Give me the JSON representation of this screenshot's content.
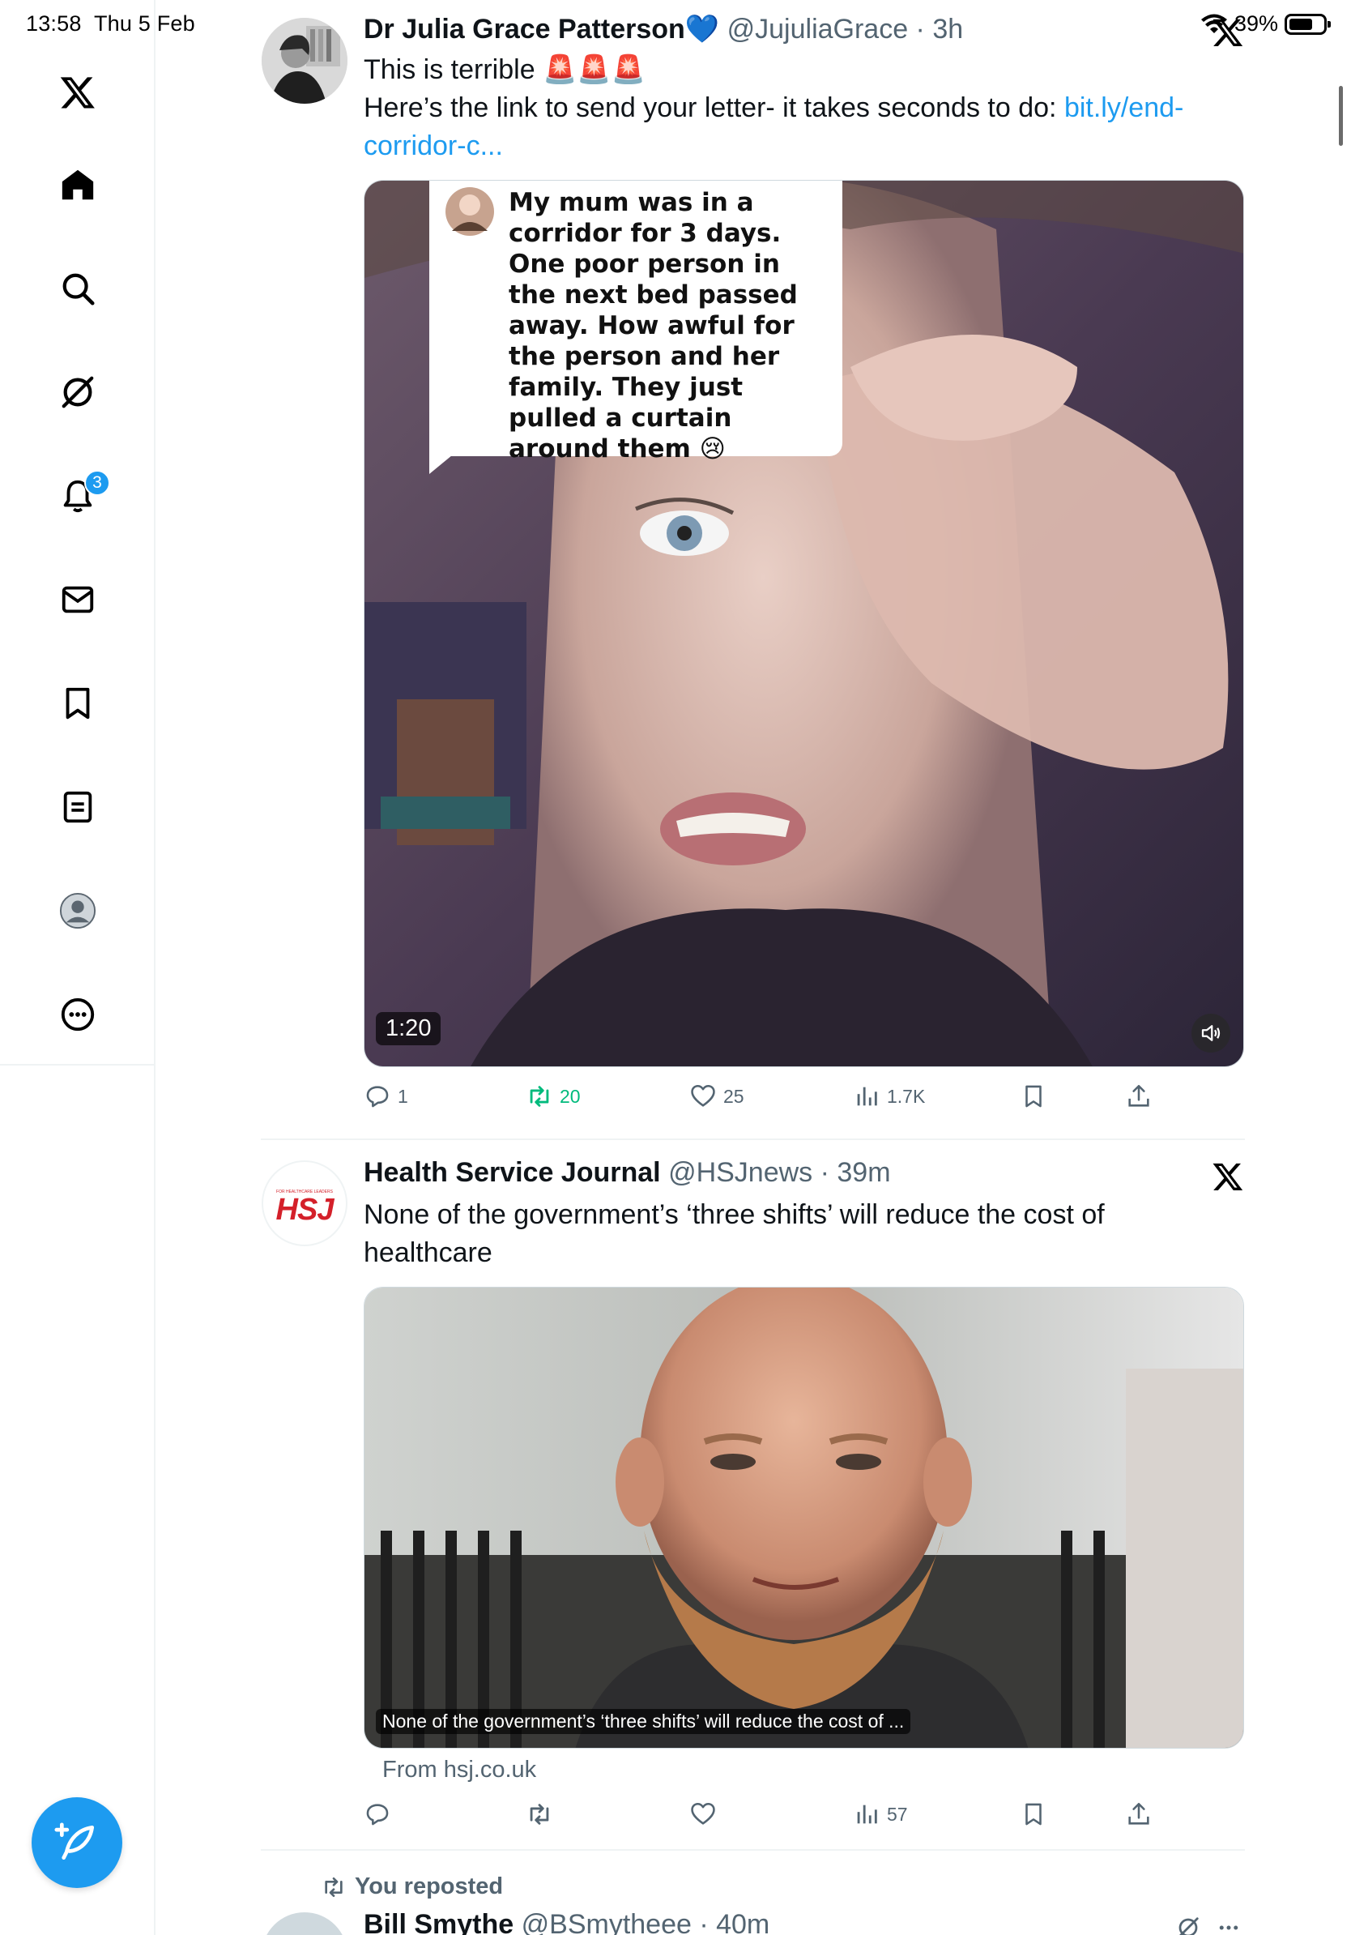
{
  "status_bar": {
    "time": "13:58",
    "date": "Thu 5 Feb",
    "battery": "39%"
  },
  "sidebar": {
    "items": [
      {
        "name": "x-logo-icon"
      },
      {
        "name": "home-icon"
      },
      {
        "name": "search-icon"
      },
      {
        "name": "grok-icon"
      },
      {
        "name": "notifications-icon",
        "badge": "3"
      },
      {
        "name": "messages-icon"
      },
      {
        "name": "bookmarks-icon"
      },
      {
        "name": "lists-icon"
      },
      {
        "name": "profile-icon"
      },
      {
        "name": "more-icon"
      }
    ],
    "compose_icon": "compose-feather-icon"
  },
  "colors": {
    "accent": "#1d9bf0",
    "retweet_green": "#00ba7c",
    "text": "#0f1419",
    "muted": "#536471"
  },
  "tweets": [
    {
      "display_name": "Dr Julia Grace Patterson",
      "verified_emoji": "💙",
      "handle_time": "@JujuliaGrace · 3h",
      "line1": "This is terrible 🚨🚨🚨",
      "line2": "Here’s the link to send your letter- it takes seconds to do: ",
      "link": "bit.ly/end-corridor-c...",
      "video": {
        "caption_text": "My mum was in a corridor for 3 days. One poor person in the next bed passed away. How awful for the person and her family. They just pulled a curtain around them 😢",
        "duration": "1:20"
      },
      "actions": {
        "replies": "1",
        "reposts": "20",
        "likes": "25",
        "views": "1.7K"
      }
    },
    {
      "display_name": "Health Service Journal",
      "handle_time": "@HSJnews · 39m",
      "text": "None of the government’s ‘three shifts’ will reduce the cost of healthcare",
      "avatar_logo": "HSJ",
      "avatar_tagline": "FOR HEALTHCARE LEADERS",
      "card": {
        "overlay_title": "None of the government’s ‘three shifts’ will reduce the cost of ...",
        "source": "From hsj.co.uk"
      },
      "actions": {
        "replies": "",
        "reposts": "",
        "likes": "",
        "views": "57"
      }
    }
  ],
  "repost_row": {
    "label": "You reposted",
    "display_name": "Bill Smythe",
    "handle_time": "@BSmytheee · 40m"
  }
}
